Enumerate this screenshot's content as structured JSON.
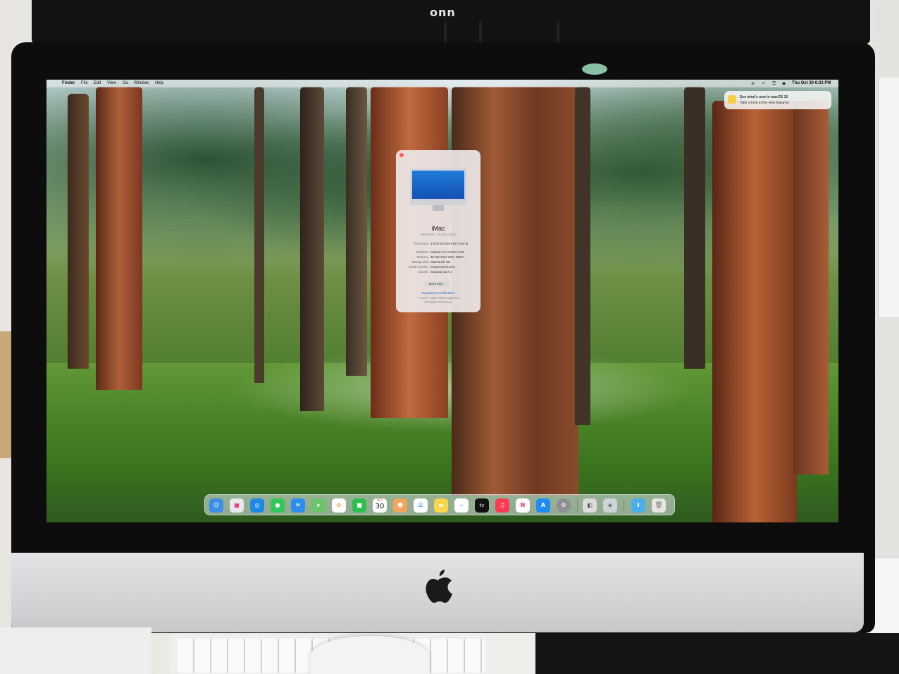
{
  "background_monitor": {
    "brand": "onn"
  },
  "menubar": {
    "items": [
      "Finder",
      "File",
      "Edit",
      "View",
      "Go",
      "Window",
      "Help"
    ],
    "datetime": "Thu Oct 30  6:33 PM"
  },
  "notification": {
    "title": "See what's new in macOS 15",
    "body": "Take a look at the new features."
  },
  "about_window": {
    "model": "iMac",
    "model_subtitle": "Retina 5K, 27-inch, 2019",
    "specs": [
      {
        "label": "Processor",
        "value": "3 GHz 6-Core Intel Core i5"
      },
      {
        "label": "Graphics",
        "value": "Radeon Pro 570X 4 GB"
      },
      {
        "label": "Memory",
        "value": "40 GB 2667 MHz DDR4"
      },
      {
        "label": "Startup disk",
        "value": "Macintosh HD"
      },
      {
        "label": "Serial number",
        "value": "C02ZH1XXXXXX"
      },
      {
        "label": "macOS",
        "value": "Sequoia 15.7.1"
      }
    ],
    "more_info_button": "More Info...",
    "regulatory_link": "Regulatory Certification",
    "copyright": "™ and © 1983–2025 Apple Inc.",
    "rights": "All Rights Reserved."
  },
  "dock": {
    "apps": [
      {
        "name": "Finder",
        "icon": "finder-icon",
        "glyph": "☺",
        "color": "#3d8fe6"
      },
      {
        "name": "Launchpad",
        "icon": "launchpad-icon",
        "glyph": "▦",
        "color": "#e8e8ee"
      },
      {
        "name": "Safari",
        "icon": "safari-icon",
        "glyph": "◎",
        "color": "#1e88e5"
      },
      {
        "name": "Messages",
        "icon": "messages-icon",
        "glyph": "●",
        "color": "#34c759"
      },
      {
        "name": "Mail",
        "icon": "mail-icon",
        "glyph": "✉",
        "color": "#2d8cf0"
      },
      {
        "name": "Maps",
        "icon": "maps-icon",
        "glyph": "➤",
        "color": "#6cc46a"
      },
      {
        "name": "Photos",
        "icon": "photos-icon",
        "glyph": "✿",
        "color": "#f0a43a"
      },
      {
        "name": "FaceTime",
        "icon": "facetime-icon",
        "glyph": "■",
        "color": "#2fbf4f"
      },
      {
        "name": "Calendar",
        "icon": "calendar-icon",
        "glyph": "",
        "color": "#ffffff"
      },
      {
        "name": "Contacts",
        "icon": "contacts-icon",
        "glyph": "☻",
        "color": "#f2a45a"
      },
      {
        "name": "Reminders",
        "icon": "reminders-icon",
        "glyph": "☰",
        "color": "#ffffff"
      },
      {
        "name": "Notes",
        "icon": "notes-icon",
        "glyph": "▬",
        "color": "#f7d64a"
      },
      {
        "name": "Freeform",
        "icon": "freeform-icon",
        "glyph": "~",
        "color": "#ffffff"
      },
      {
        "name": "TV",
        "icon": "tv-icon",
        "glyph": "",
        "color": "#111111"
      },
      {
        "name": "Music",
        "icon": "music-icon",
        "glyph": "♫",
        "color": "#fa3b52"
      },
      {
        "name": "News",
        "icon": "news-icon",
        "glyph": "N",
        "color": "#ffffff"
      },
      {
        "name": "App Store",
        "icon": "app-store-icon",
        "glyph": "A",
        "color": "#1f8cf5"
      },
      {
        "name": "System Settings",
        "icon": "settings-gear-icon",
        "glyph": "⚙",
        "color": "#8e8e93"
      },
      {
        "name": "Preview",
        "icon": "preview-icon",
        "glyph": "◧",
        "color": "#dcdcdc"
      },
      {
        "name": "Image Capture",
        "icon": "image-capture-icon",
        "glyph": "◈",
        "color": "#cfd4d8"
      },
      {
        "name": "Downloads",
        "icon": "downloads-folder-icon",
        "glyph": "⬇",
        "color": "#4aaee8"
      },
      {
        "name": "Trash",
        "icon": "trash-icon",
        "glyph": "🗑",
        "color": "#e6e6e6"
      }
    ],
    "calendar": {
      "month": "OCT",
      "day": "30"
    },
    "tv_label": "tv"
  }
}
